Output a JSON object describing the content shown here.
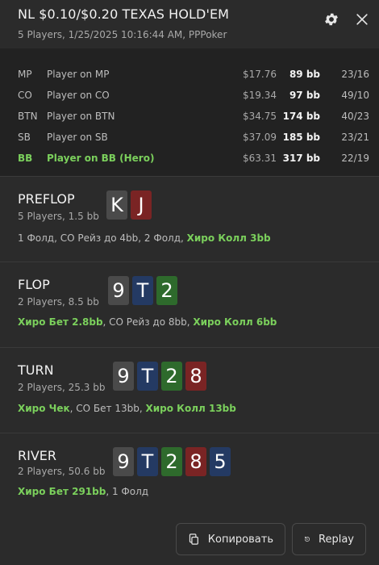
{
  "header": {
    "title": "NL $0.10/$0.20 TEXAS HOLD'EM",
    "subtitle": "5 Players, 1/25/2025 10:16:44 AM, PPPoker"
  },
  "players": [
    {
      "pos": "MP",
      "name": "Player on MP",
      "stack": "$17.76",
      "bb": "89 bb",
      "stat": "23/16"
    },
    {
      "pos": "CO",
      "name": "Player on CO",
      "stack": "$19.34",
      "bb": "97 bb",
      "stat": "49/10"
    },
    {
      "pos": "BTN",
      "name": "Player on BTN",
      "stack": "$34.75",
      "bb": "174 bb",
      "stat": "40/23"
    },
    {
      "pos": "SB",
      "name": "Player on SB",
      "stack": "$37.09",
      "bb": "185 bb",
      "stat": "23/21"
    },
    {
      "pos": "BB",
      "name": "Player on BB (Hero)",
      "stack": "$63.31",
      "bb": "317 bb",
      "stat": "22/19"
    }
  ],
  "streets": {
    "preflop": {
      "name": "PREFLOP",
      "info": "5 Players, 1.5 bb",
      "cards": [
        {
          "rank": "K",
          "suit": "spades"
        },
        {
          "rank": "J",
          "suit": "hearts"
        }
      ],
      "actions": [
        {
          "text": "1 Фолд, CO Рейз до 4bb, 2 Фолд, ",
          "hero": false
        },
        {
          "text": "Хиро Колл 3bb",
          "hero": true
        }
      ]
    },
    "flop": {
      "name": "FLOP",
      "info": "2 Players, 8.5 bb",
      "cards": [
        {
          "rank": "9",
          "suit": "spades"
        },
        {
          "rank": "T",
          "suit": "diamonds"
        },
        {
          "rank": "2",
          "suit": "clubs"
        }
      ],
      "actions": [
        {
          "text": "Хиро Бет 2.8bb",
          "hero": true
        },
        {
          "text": ", CO Рейз до 8bb, ",
          "hero": false
        },
        {
          "text": "Хиро Колл 6bb",
          "hero": true
        }
      ]
    },
    "turn": {
      "name": "TURN",
      "info": "2 Players, 25.3 bb",
      "cards": [
        {
          "rank": "9",
          "suit": "spades"
        },
        {
          "rank": "T",
          "suit": "diamonds"
        },
        {
          "rank": "2",
          "suit": "clubs"
        },
        {
          "rank": "8",
          "suit": "hearts"
        }
      ],
      "actions": [
        {
          "text": "Хиро Чек",
          "hero": true
        },
        {
          "text": ", CO Бет 13bb, ",
          "hero": false
        },
        {
          "text": "Хиро Колл 13bb",
          "hero": true
        }
      ]
    },
    "river": {
      "name": "RIVER",
      "info": "2 Players, 50.6 bb",
      "cards": [
        {
          "rank": "9",
          "suit": "spades"
        },
        {
          "rank": "T",
          "suit": "diamonds"
        },
        {
          "rank": "2",
          "suit": "clubs"
        },
        {
          "rank": "8",
          "suit": "hearts"
        },
        {
          "rank": "5",
          "suit": "diamonds"
        }
      ],
      "actions": [
        {
          "text": "Хиро Бет 291bb",
          "hero": true
        },
        {
          "text": ", 1 Фолд",
          "hero": false
        }
      ]
    }
  },
  "suit_colors": {
    "spades": "#4a4a4a",
    "hearts": "#7a2424",
    "diamonds": "#243a63",
    "clubs": "#2e6a2c"
  },
  "buttons": {
    "copy": "Копировать",
    "replay": "Replay"
  },
  "icons": {
    "settings": "gear-icon",
    "close": "close-icon",
    "copy": "copy-icon",
    "replay": "replay-icon"
  }
}
